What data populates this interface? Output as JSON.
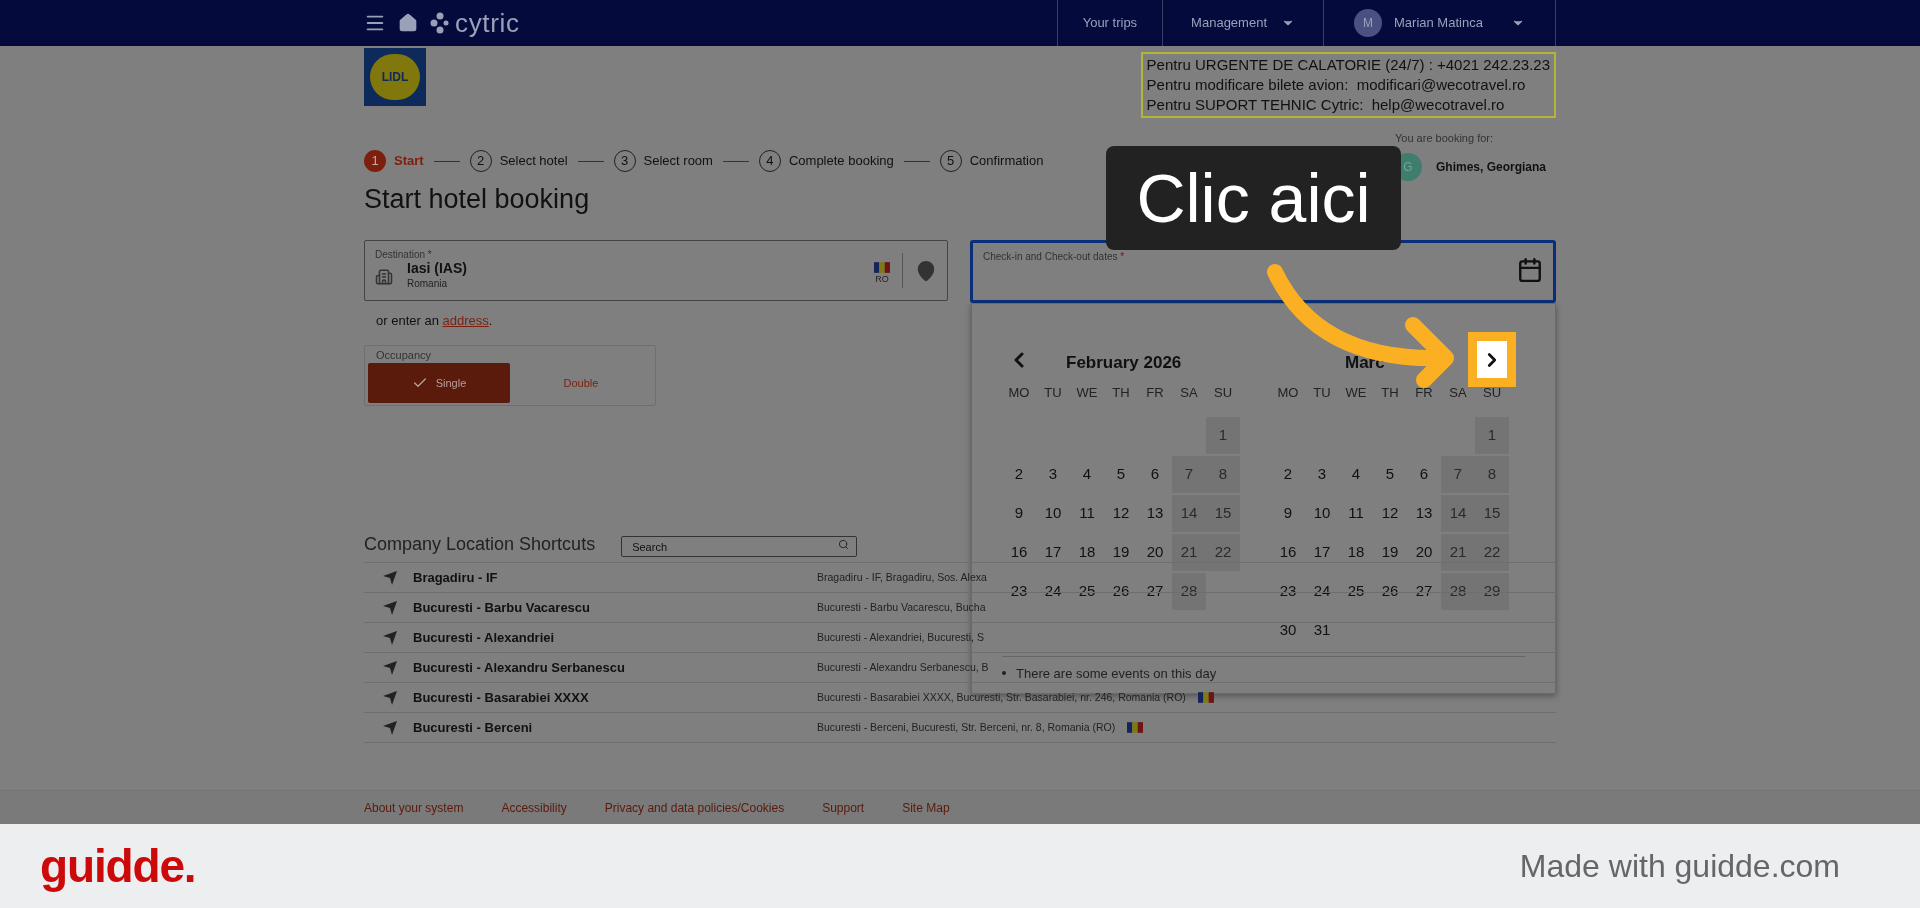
{
  "nav": {
    "logo": "cytric",
    "items": [
      {
        "label": "Your trips",
        "dropdown": false
      },
      {
        "label": "Management",
        "dropdown": true
      }
    ],
    "user": {
      "initial": "M",
      "name": "Marian Matinca"
    }
  },
  "company_logo": {
    "text": "LIDL"
  },
  "contact_lines": [
    "Pentru URGENTE DE CALATORIE (24/7) : +4021 242.23.23",
    "Pentru modificare bilete avion:  modificari@wecotravel.ro",
    "Pentru SUPORT TEHNIC Cytric:  help@wecotravel.ro"
  ],
  "steps": [
    {
      "number": "1",
      "label": "Start",
      "selected": true
    },
    {
      "number": "2",
      "label": "Select hotel",
      "selected": false
    },
    {
      "number": "3",
      "label": "Select room",
      "selected": false
    },
    {
      "number": "4",
      "label": "Complete booking",
      "selected": false
    },
    {
      "number": "5",
      "label": "Confirmation",
      "selected": false
    }
  ],
  "booking_for": {
    "label": "You are booking for:",
    "initial": "G",
    "name": "Ghimes, Georgiana"
  },
  "title": "Start hotel booking",
  "destination": {
    "label": "Destination",
    "required_mark": "*",
    "value": "Iasi (IAS)",
    "country": "Romania",
    "country_code": "RO"
  },
  "address_hint": {
    "before": "or enter an",
    "link": "address",
    "after": "."
  },
  "occupancy": {
    "label": "Occupancy",
    "options": [
      {
        "label": "Single",
        "selected": true
      },
      {
        "label": "Double",
        "selected": false
      }
    ]
  },
  "dates_field": {
    "label": "Check-in and Check-out dates",
    "required_mark": "*"
  },
  "calendar": {
    "months": [
      {
        "title": "February 2026",
        "weekdays": [
          "MO",
          "TU",
          "WE",
          "TH",
          "FR",
          "SA",
          "SU"
        ],
        "weeks": [
          [
            {
              "day": "1",
              "weekend": true
            }
          ],
          [
            {
              "day": "2",
              "weekend": false
            },
            {
              "day": "3",
              "weekend": false
            },
            {
              "day": "4",
              "weekend": false
            },
            {
              "day": "5",
              "weekend": false
            },
            {
              "day": "6",
              "weekend": false
            },
            {
              "day": "7",
              "weekend": true
            },
            {
              "day": "8",
              "weekend": true
            }
          ],
          [
            {
              "day": "9",
              "weekend": false
            },
            {
              "day": "10",
              "weekend": false
            },
            {
              "day": "11",
              "weekend": false
            },
            {
              "day": "12",
              "weekend": false
            },
            {
              "day": "13",
              "weekend": false
            },
            {
              "day": "14",
              "weekend": true
            },
            {
              "day": "15",
              "weekend": true
            }
          ],
          [
            {
              "day": "16",
              "weekend": false
            },
            {
              "day": "17",
              "weekend": false
            },
            {
              "day": "18",
              "weekend": false
            },
            {
              "day": "19",
              "weekend": false
            },
            {
              "day": "20",
              "weekend": false
            },
            {
              "day": "21",
              "weekend": true
            },
            {
              "day": "22",
              "weekend": true
            }
          ],
          [
            {
              "day": "23",
              "weekend": false
            },
            {
              "day": "24",
              "weekend": false
            },
            {
              "day": "25",
              "weekend": false
            },
            {
              "day": "26",
              "weekend": false
            },
            {
              "day": "27",
              "weekend": false
            },
            {
              "day": "28",
              "weekend": true
            }
          ]
        ]
      },
      {
        "title": "Marc",
        "weekdays": [
          "MO",
          "TU",
          "WE",
          "TH",
          "FR",
          "SA",
          "SU"
        ],
        "weeks": [
          [
            {
              "day": "1",
              "weekend": true
            }
          ],
          [
            {
              "day": "2",
              "weekend": false
            },
            {
              "day": "3",
              "weekend": false
            },
            {
              "day": "4",
              "weekend": false
            },
            {
              "day": "5",
              "weekend": false
            },
            {
              "day": "6",
              "weekend": false
            },
            {
              "day": "7",
              "weekend": true
            },
            {
              "day": "8",
              "weekend": true
            }
          ],
          [
            {
              "day": "9",
              "weekend": false
            },
            {
              "day": "10",
              "weekend": false
            },
            {
              "day": "11",
              "weekend": false
            },
            {
              "day": "12",
              "weekend": false
            },
            {
              "day": "13",
              "weekend": false
            },
            {
              "day": "14",
              "weekend": true
            },
            {
              "day": "15",
              "weekend": true
            }
          ],
          [
            {
              "day": "16",
              "weekend": false
            },
            {
              "day": "17",
              "weekend": false
            },
            {
              "day": "18",
              "weekend": false
            },
            {
              "day": "19",
              "weekend": false
            },
            {
              "day": "20",
              "weekend": false
            },
            {
              "day": "21",
              "weekend": true
            },
            {
              "day": "22",
              "weekend": true
            }
          ],
          [
            {
              "day": "23",
              "weekend": false
            },
            {
              "day": "24",
              "weekend": false
            },
            {
              "day": "25",
              "weekend": false
            },
            {
              "day": "26",
              "weekend": false
            },
            {
              "day": "27",
              "weekend": false
            },
            {
              "day": "28",
              "weekend": true
            },
            {
              "day": "29",
              "weekend": true
            }
          ],
          [
            {
              "day": "30",
              "weekend": false
            },
            {
              "day": "31",
              "weekend": false
            }
          ]
        ]
      }
    ],
    "legend": "There are some events on this day"
  },
  "callout": {
    "text": "Clic aici"
  },
  "shortcuts": {
    "title": "Company Location Shortcuts",
    "search_placeholder": "Search",
    "rows": [
      {
        "name": "Bragadiru - IF",
        "address": "Bragadiru - IF, Bragadiru, Sos. Alexa",
        "flag": false
      },
      {
        "name": "Bucuresti - Barbu Vacarescu",
        "address": "Bucuresti - Barbu Vacarescu, Bucha",
        "flag": false
      },
      {
        "name": "Bucuresti - Alexandriei",
        "address": "Bucuresti - Alexandriei, Bucuresti, S",
        "flag": false
      },
      {
        "name": "Bucuresti - Alexandru Serbanescu",
        "address": "Bucuresti - Alexandru Serbanescu, B",
        "flag": false
      },
      {
        "name": "Bucuresti - Basarabiei XXXX",
        "address": "Bucuresti - Basarabiei XXXX, Bucuresti, Str. Basarabiei, nr. 246, Romania (RO)",
        "flag": true
      },
      {
        "name": "Bucuresti - Berceni",
        "address": "Bucuresti - Berceni, Bucuresti, Str. Berceni, nr. 8, Romania (RO)",
        "flag": true
      }
    ]
  },
  "footer_links": [
    "About your system",
    "Accessibility",
    "Privacy and data policies/Cookies",
    "Support",
    "Site Map"
  ],
  "banner": {
    "logo": "guidde.",
    "tagline": "Made with guidde.com"
  }
}
